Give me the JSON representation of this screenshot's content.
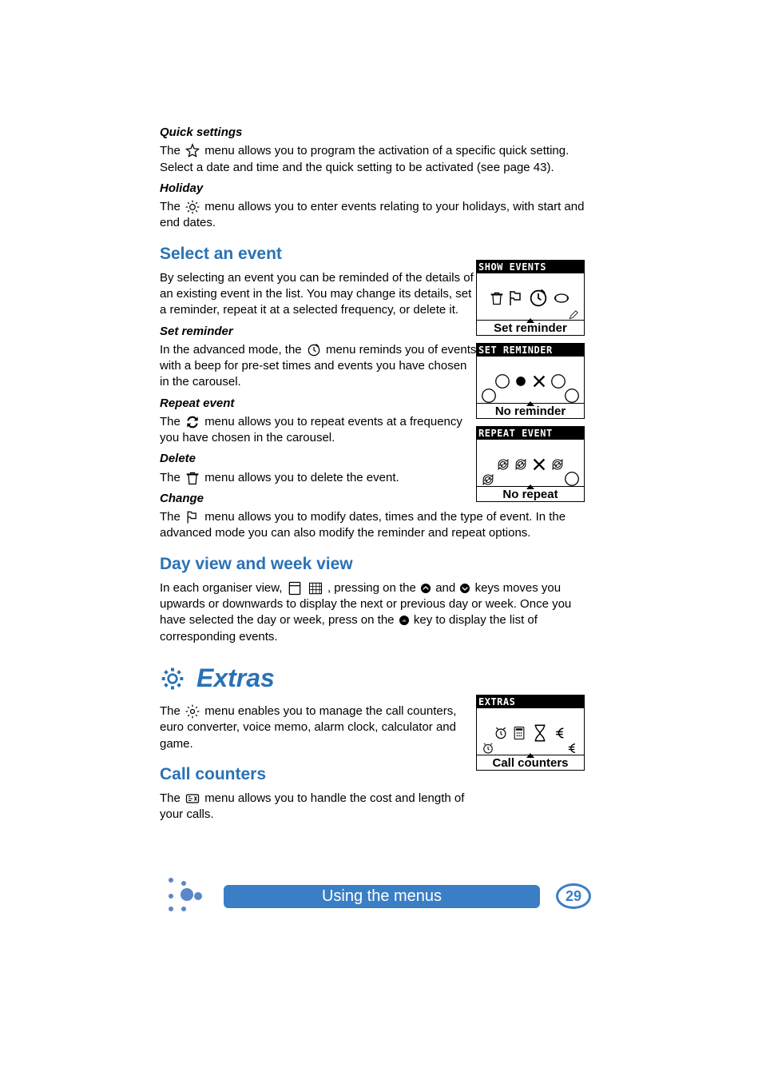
{
  "sections": {
    "quick_settings": {
      "heading": "Quick settings",
      "text1_pre": "The ",
      "text1_post": " menu allows you to program the activation of a specific quick setting.  Select a date and time and the quick setting to be activated (see page 43)."
    },
    "holiday": {
      "heading": "Holiday",
      "text_pre": "The ",
      "text_post": " menu allows you to enter events relating to your holidays, with start and end dates."
    },
    "select_event": {
      "heading": "Select an event",
      "text": "By selecting an event you can be reminded of the details of an existing event in the list.  You may change its details, set a reminder, repeat it at a selected frequency, or delete it."
    },
    "set_reminder": {
      "heading": "Set reminder",
      "text_pre": "In the advanced mode, the ",
      "text_post": " menu reminds you of events with a beep for pre-set times and events you have chosen in the carousel."
    },
    "repeat_event": {
      "heading": "Repeat event",
      "text_pre": "The ",
      "text_post": " menu allows you to repeat events at a frequency you have chosen in the carousel."
    },
    "delete": {
      "heading": "Delete",
      "text_pre": "The ",
      "text_post": " menu allows you to delete the event."
    },
    "change": {
      "heading": "Change",
      "text_pre": "The ",
      "text_post": " menu allows you to modify dates, times and the type of event.  In the advanced mode you can also modify the reminder and repeat options."
    },
    "day_week": {
      "heading": "Day view and week view",
      "text1_pre": "In each organiser view, ",
      "text1_mid": " , pressing on the ",
      "text1_mid2": " and ",
      "text1_post": " keys moves you upwards or downwards to display the next or previous day or week.  Once you have selected the day or week, press on the ",
      "text1_end": " key to display the list of corresponding events."
    },
    "extras": {
      "heading": "Extras",
      "text_pre": "The ",
      "text_post": " menu enables you to manage the call counters, euro converter, voice memo, alarm clock, calculator and game."
    },
    "call_counters": {
      "heading": "Call counters",
      "text_pre": "The ",
      "text_post": " menu allows you to handle the cost and length of your calls."
    }
  },
  "screens": {
    "s1": {
      "title": "SHOW EVENTS",
      "label": "Set reminder"
    },
    "s2": {
      "title": "SET REMINDER",
      "label": "No reminder"
    },
    "s3": {
      "title": "REPEAT EVENT",
      "label": "No repeat"
    },
    "s4": {
      "title": "EXTRAS",
      "label": "Call counters"
    }
  },
  "footer": {
    "title": "Using the menus",
    "page": "29"
  }
}
